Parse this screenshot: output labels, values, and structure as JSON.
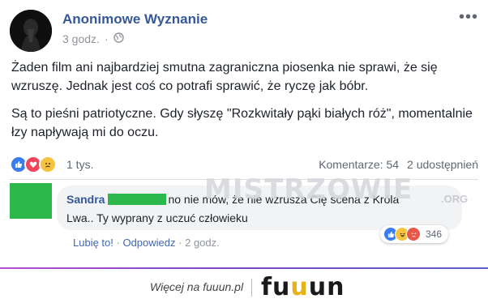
{
  "post": {
    "page_name": "Anonimowe Wyznanie",
    "time": "3 godz.",
    "time_separator": "·",
    "privacy_icon": "globe-icon",
    "more_icon": "more-dots-icon",
    "more_label": "•••",
    "paragraphs": [
      "Żaden film ani najbardziej smutna zagraniczna piosenka nie sprawi, że się wzruszę. Jednak jest coś co potrafi sprawić, że ryczę jak bóbr.",
      "Są to pieśni patriotyczne. Gdy słyszę \"Rozkwitały pąki białych róż\", momentalnie łzy napływają mi do oczu."
    ],
    "reactions": {
      "icons": [
        "like-icon",
        "love-icon",
        "sad-icon"
      ],
      "count": "1 tys.",
      "comments": "Komentarze: 54",
      "shares": "2 udostępnień"
    }
  },
  "comment": {
    "author": "Sandra",
    "text_line1": "no nie mów, że nie wzrusza Cię scena z Króla",
    "text_line2": "Lwa.. Ty wyprany z uczuć człowieku",
    "reactions": {
      "icons": [
        "like-icon",
        "haha-icon",
        "angry-icon"
      ],
      "count": "346"
    },
    "actions": {
      "like": "Lubię to!",
      "separator": "·",
      "reply": "Odpowiedz",
      "time": "2 godz."
    }
  },
  "watermark": {
    "text": "MISTRZOWIE",
    "suffix": ".ORG"
  },
  "footer": {
    "text": "Więcej na fuuun.pl",
    "logo_part1": "fu",
    "logo_part2": "u",
    "logo_part3": "un"
  },
  "colors": {
    "link_blue": "#365899",
    "redaction_green": "#2cb84a",
    "like_blue": "#3a7df0",
    "love_red": "#f0455a",
    "sad_yellow": "#f6c33e",
    "logo_accent": "#e8b21c"
  }
}
